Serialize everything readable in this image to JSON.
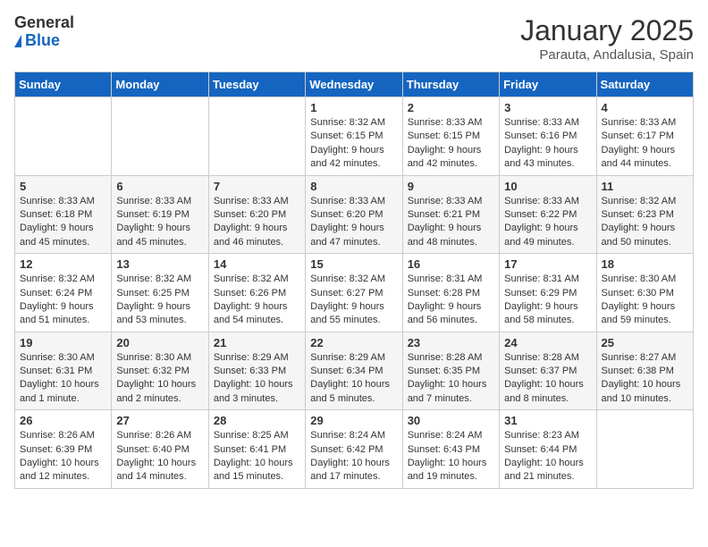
{
  "header": {
    "logo_general": "General",
    "logo_blue": "Blue",
    "title": "January 2025",
    "location": "Parauta, Andalusia, Spain"
  },
  "days_of_week": [
    "Sunday",
    "Monday",
    "Tuesday",
    "Wednesday",
    "Thursday",
    "Friday",
    "Saturday"
  ],
  "weeks": [
    [
      {
        "day": "",
        "info": ""
      },
      {
        "day": "",
        "info": ""
      },
      {
        "day": "",
        "info": ""
      },
      {
        "day": "1",
        "info": "Sunrise: 8:32 AM\nSunset: 6:15 PM\nDaylight: 9 hours and 42 minutes."
      },
      {
        "day": "2",
        "info": "Sunrise: 8:33 AM\nSunset: 6:15 PM\nDaylight: 9 hours and 42 minutes."
      },
      {
        "day": "3",
        "info": "Sunrise: 8:33 AM\nSunset: 6:16 PM\nDaylight: 9 hours and 43 minutes."
      },
      {
        "day": "4",
        "info": "Sunrise: 8:33 AM\nSunset: 6:17 PM\nDaylight: 9 hours and 44 minutes."
      }
    ],
    [
      {
        "day": "5",
        "info": "Sunrise: 8:33 AM\nSunset: 6:18 PM\nDaylight: 9 hours and 45 minutes."
      },
      {
        "day": "6",
        "info": "Sunrise: 8:33 AM\nSunset: 6:19 PM\nDaylight: 9 hours and 45 minutes."
      },
      {
        "day": "7",
        "info": "Sunrise: 8:33 AM\nSunset: 6:20 PM\nDaylight: 9 hours and 46 minutes."
      },
      {
        "day": "8",
        "info": "Sunrise: 8:33 AM\nSunset: 6:20 PM\nDaylight: 9 hours and 47 minutes."
      },
      {
        "day": "9",
        "info": "Sunrise: 8:33 AM\nSunset: 6:21 PM\nDaylight: 9 hours and 48 minutes."
      },
      {
        "day": "10",
        "info": "Sunrise: 8:33 AM\nSunset: 6:22 PM\nDaylight: 9 hours and 49 minutes."
      },
      {
        "day": "11",
        "info": "Sunrise: 8:32 AM\nSunset: 6:23 PM\nDaylight: 9 hours and 50 minutes."
      }
    ],
    [
      {
        "day": "12",
        "info": "Sunrise: 8:32 AM\nSunset: 6:24 PM\nDaylight: 9 hours and 51 minutes."
      },
      {
        "day": "13",
        "info": "Sunrise: 8:32 AM\nSunset: 6:25 PM\nDaylight: 9 hours and 53 minutes."
      },
      {
        "day": "14",
        "info": "Sunrise: 8:32 AM\nSunset: 6:26 PM\nDaylight: 9 hours and 54 minutes."
      },
      {
        "day": "15",
        "info": "Sunrise: 8:32 AM\nSunset: 6:27 PM\nDaylight: 9 hours and 55 minutes."
      },
      {
        "day": "16",
        "info": "Sunrise: 8:31 AM\nSunset: 6:28 PM\nDaylight: 9 hours and 56 minutes."
      },
      {
        "day": "17",
        "info": "Sunrise: 8:31 AM\nSunset: 6:29 PM\nDaylight: 9 hours and 58 minutes."
      },
      {
        "day": "18",
        "info": "Sunrise: 8:30 AM\nSunset: 6:30 PM\nDaylight: 9 hours and 59 minutes."
      }
    ],
    [
      {
        "day": "19",
        "info": "Sunrise: 8:30 AM\nSunset: 6:31 PM\nDaylight: 10 hours and 1 minute."
      },
      {
        "day": "20",
        "info": "Sunrise: 8:30 AM\nSunset: 6:32 PM\nDaylight: 10 hours and 2 minutes."
      },
      {
        "day": "21",
        "info": "Sunrise: 8:29 AM\nSunset: 6:33 PM\nDaylight: 10 hours and 3 minutes."
      },
      {
        "day": "22",
        "info": "Sunrise: 8:29 AM\nSunset: 6:34 PM\nDaylight: 10 hours and 5 minutes."
      },
      {
        "day": "23",
        "info": "Sunrise: 8:28 AM\nSunset: 6:35 PM\nDaylight: 10 hours and 7 minutes."
      },
      {
        "day": "24",
        "info": "Sunrise: 8:28 AM\nSunset: 6:37 PM\nDaylight: 10 hours and 8 minutes."
      },
      {
        "day": "25",
        "info": "Sunrise: 8:27 AM\nSunset: 6:38 PM\nDaylight: 10 hours and 10 minutes."
      }
    ],
    [
      {
        "day": "26",
        "info": "Sunrise: 8:26 AM\nSunset: 6:39 PM\nDaylight: 10 hours and 12 minutes."
      },
      {
        "day": "27",
        "info": "Sunrise: 8:26 AM\nSunset: 6:40 PM\nDaylight: 10 hours and 14 minutes."
      },
      {
        "day": "28",
        "info": "Sunrise: 8:25 AM\nSunset: 6:41 PM\nDaylight: 10 hours and 15 minutes."
      },
      {
        "day": "29",
        "info": "Sunrise: 8:24 AM\nSunset: 6:42 PM\nDaylight: 10 hours and 17 minutes."
      },
      {
        "day": "30",
        "info": "Sunrise: 8:24 AM\nSunset: 6:43 PM\nDaylight: 10 hours and 19 minutes."
      },
      {
        "day": "31",
        "info": "Sunrise: 8:23 AM\nSunset: 6:44 PM\nDaylight: 10 hours and 21 minutes."
      },
      {
        "day": "",
        "info": ""
      }
    ]
  ]
}
